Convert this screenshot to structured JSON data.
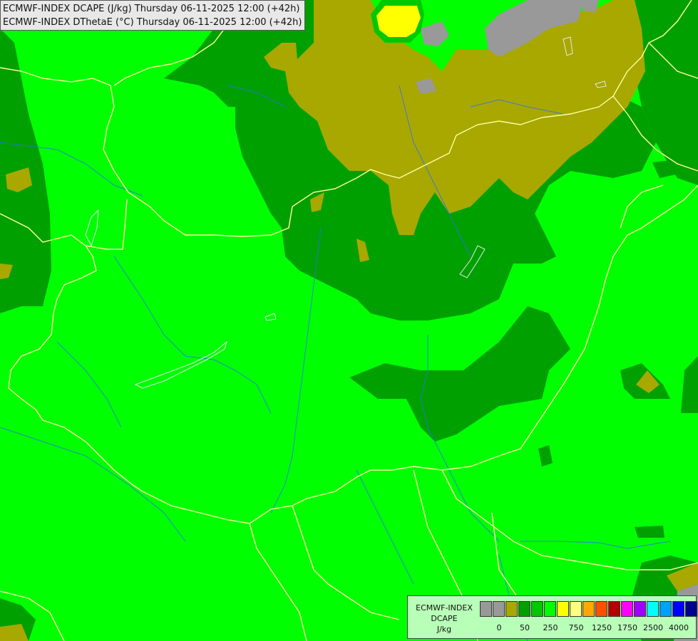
{
  "map": {
    "title_line1": "ECMWF-INDEX DCAPE (J/kg) Thursday 06-11-2025 12:00 (+42h)",
    "title_line2": "ECMWF-INDEX DThetaE (°C) Thursday 06-11-2025 12:00 (+42h)"
  },
  "colors": {
    "background_bright_green": "#00ff00",
    "dark_green": "#00a000",
    "olive": "#a8a800",
    "grey": "#999999",
    "yellow": "#ffff00",
    "border_lines": "#ffffa0",
    "rivers": "#2d6cff"
  },
  "legend": {
    "title_line1": "ECMWF-INDEX",
    "title_line2": "DCAPE",
    "title_line3": "J/kg",
    "colors": [
      "#999999",
      "#999999",
      "#a8a800",
      "#00a000",
      "#00c800",
      "#00ff00",
      "#ffff00",
      "#ffff80",
      "#ffa800",
      "#ff5000",
      "#b40000",
      "#ff00ff",
      "#a000ff",
      "#00ffff",
      "#00a0ff",
      "#0000ff",
      "#000090"
    ],
    "tick_labels": [
      "0",
      "50",
      "250",
      "750",
      "1250",
      "1750",
      "2500",
      "4000"
    ]
  }
}
